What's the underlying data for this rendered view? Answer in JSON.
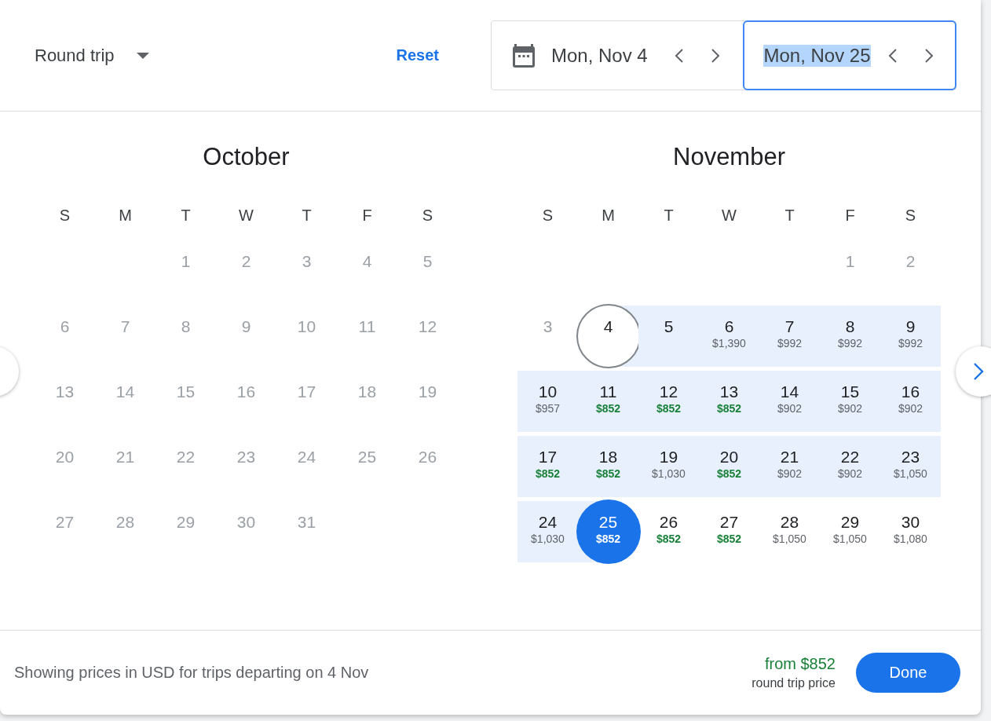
{
  "header": {
    "trip_type": "Round trip",
    "reset": "Reset",
    "dates": [
      {
        "kind": "departure",
        "value": "Mon, Nov 4",
        "selected": false,
        "text_highlighted": false
      },
      {
        "kind": "return",
        "value": "Mon, Nov 25",
        "selected": true,
        "text_highlighted": true
      }
    ]
  },
  "months": [
    {
      "name": "October",
      "weekdays": [
        "S",
        "M",
        "T",
        "W",
        "T",
        "F",
        "S"
      ],
      "weeks": [
        [
          {
            "kind": "blank"
          },
          {
            "kind": "blank"
          },
          {
            "day": "1",
            "past": true,
            "in_range": false,
            "selected": false,
            "kind": "day"
          },
          {
            "day": "2",
            "past": true,
            "in_range": false,
            "selected": false,
            "kind": "day"
          },
          {
            "day": "3",
            "past": true,
            "in_range": false,
            "selected": false,
            "kind": "day"
          },
          {
            "day": "4",
            "past": true,
            "in_range": false,
            "selected": false,
            "kind": "day"
          },
          {
            "day": "5",
            "past": true,
            "in_range": false,
            "selected": false,
            "kind": "day"
          }
        ],
        [
          {
            "day": "6",
            "past": true,
            "in_range": false,
            "selected": false,
            "kind": "day"
          },
          {
            "day": "7",
            "past": true,
            "in_range": false,
            "selected": false,
            "kind": "day"
          },
          {
            "day": "8",
            "past": true,
            "in_range": false,
            "selected": false,
            "kind": "day"
          },
          {
            "day": "9",
            "past": true,
            "in_range": false,
            "selected": false,
            "kind": "day"
          },
          {
            "day": "10",
            "past": true,
            "in_range": false,
            "selected": false,
            "kind": "day"
          },
          {
            "day": "11",
            "past": true,
            "in_range": false,
            "selected": false,
            "kind": "day"
          },
          {
            "day": "12",
            "past": true,
            "in_range": false,
            "selected": false,
            "kind": "day"
          }
        ],
        [
          {
            "day": "13",
            "past": true,
            "in_range": false,
            "selected": false,
            "kind": "day"
          },
          {
            "day": "14",
            "past": true,
            "in_range": false,
            "selected": false,
            "kind": "day"
          },
          {
            "day": "15",
            "past": true,
            "in_range": false,
            "selected": false,
            "kind": "day"
          },
          {
            "day": "16",
            "past": true,
            "in_range": false,
            "selected": false,
            "kind": "day"
          },
          {
            "day": "17",
            "past": true,
            "in_range": false,
            "selected": false,
            "kind": "day"
          },
          {
            "day": "18",
            "past": true,
            "in_range": false,
            "selected": false,
            "kind": "day"
          },
          {
            "day": "19",
            "past": true,
            "in_range": false,
            "selected": false,
            "kind": "day"
          }
        ],
        [
          {
            "day": "20",
            "past": true,
            "in_range": false,
            "selected": false,
            "kind": "day"
          },
          {
            "day": "21",
            "past": true,
            "in_range": false,
            "selected": false,
            "kind": "day"
          },
          {
            "day": "22",
            "past": true,
            "in_range": false,
            "selected": false,
            "kind": "day"
          },
          {
            "day": "23",
            "past": true,
            "in_range": false,
            "selected": false,
            "kind": "day"
          },
          {
            "day": "24",
            "past": true,
            "in_range": false,
            "selected": false,
            "kind": "day"
          },
          {
            "day": "25",
            "past": true,
            "in_range": false,
            "selected": false,
            "kind": "day"
          },
          {
            "day": "26",
            "past": true,
            "in_range": false,
            "selected": false,
            "kind": "day"
          }
        ],
        [
          {
            "day": "27",
            "past": true,
            "in_range": false,
            "selected": false,
            "kind": "day"
          },
          {
            "day": "28",
            "past": true,
            "in_range": false,
            "selected": false,
            "kind": "day"
          },
          {
            "day": "29",
            "past": true,
            "in_range": false,
            "selected": false,
            "kind": "day"
          },
          {
            "day": "30",
            "past": true,
            "in_range": false,
            "selected": false,
            "kind": "day"
          },
          {
            "day": "31",
            "past": true,
            "in_range": false,
            "selected": false,
            "kind": "day"
          },
          {
            "kind": "blank"
          },
          {
            "kind": "blank"
          }
        ]
      ]
    },
    {
      "name": "November",
      "weekdays": [
        "S",
        "M",
        "T",
        "W",
        "T",
        "F",
        "S"
      ],
      "weeks": [
        [
          {
            "kind": "blank"
          },
          {
            "kind": "blank"
          },
          {
            "kind": "blank"
          },
          {
            "kind": "blank"
          },
          {
            "kind": "blank"
          },
          {
            "day": "1",
            "past": true,
            "in_range": false,
            "selected": false,
            "kind": "day"
          },
          {
            "day": "2",
            "past": true,
            "in_range": false,
            "selected": false,
            "kind": "day"
          }
        ],
        [
          {
            "day": "3",
            "past": true,
            "in_range": false,
            "selected": false,
            "kind": "day"
          },
          {
            "day": "4",
            "past": false,
            "in_range": true,
            "selected": true,
            "kind": "departure"
          },
          {
            "day": "5",
            "past": false,
            "in_range": true,
            "selected": false,
            "kind": "day"
          },
          {
            "day": "6",
            "price": "$1,390",
            "cheap": false,
            "past": false,
            "in_range": true,
            "selected": false,
            "kind": "day"
          },
          {
            "day": "7",
            "price": "$992",
            "cheap": false,
            "past": false,
            "in_range": true,
            "selected": false,
            "kind": "day"
          },
          {
            "day": "8",
            "price": "$992",
            "cheap": false,
            "past": false,
            "in_range": true,
            "selected": false,
            "kind": "day"
          },
          {
            "day": "9",
            "price": "$992",
            "cheap": false,
            "past": false,
            "in_range": true,
            "selected": false,
            "kind": "day"
          }
        ],
        [
          {
            "day": "10",
            "price": "$957",
            "cheap": false,
            "past": false,
            "in_range": true,
            "selected": false,
            "kind": "day"
          },
          {
            "day": "11",
            "price": "$852",
            "cheap": true,
            "past": false,
            "in_range": true,
            "selected": false,
            "kind": "day"
          },
          {
            "day": "12",
            "price": "$852",
            "cheap": true,
            "past": false,
            "in_range": true,
            "selected": false,
            "kind": "day"
          },
          {
            "day": "13",
            "price": "$852",
            "cheap": true,
            "past": false,
            "in_range": true,
            "selected": false,
            "kind": "day"
          },
          {
            "day": "14",
            "price": "$902",
            "cheap": false,
            "past": false,
            "in_range": true,
            "selected": false,
            "kind": "day"
          },
          {
            "day": "15",
            "price": "$902",
            "cheap": false,
            "past": false,
            "in_range": true,
            "selected": false,
            "kind": "day"
          },
          {
            "day": "16",
            "price": "$902",
            "cheap": false,
            "past": false,
            "in_range": true,
            "selected": false,
            "kind": "day"
          }
        ],
        [
          {
            "day": "17",
            "price": "$852",
            "cheap": true,
            "past": false,
            "in_range": true,
            "selected": false,
            "kind": "day"
          },
          {
            "day": "18",
            "price": "$852",
            "cheap": true,
            "past": false,
            "in_range": true,
            "selected": false,
            "kind": "day"
          },
          {
            "day": "19",
            "price": "$1,030",
            "cheap": false,
            "past": false,
            "in_range": true,
            "selected": false,
            "kind": "day"
          },
          {
            "day": "20",
            "price": "$852",
            "cheap": true,
            "past": false,
            "in_range": true,
            "selected": false,
            "kind": "day"
          },
          {
            "day": "21",
            "price": "$902",
            "cheap": false,
            "past": false,
            "in_range": true,
            "selected": false,
            "kind": "day"
          },
          {
            "day": "22",
            "price": "$902",
            "cheap": false,
            "past": false,
            "in_range": true,
            "selected": false,
            "kind": "day"
          },
          {
            "day": "23",
            "price": "$1,050",
            "cheap": false,
            "past": false,
            "in_range": true,
            "selected": false,
            "kind": "day"
          }
        ],
        [
          {
            "day": "24",
            "price": "$1,030",
            "cheap": false,
            "past": false,
            "in_range": true,
            "selected": false,
            "kind": "day"
          },
          {
            "day": "25",
            "price": "$852",
            "cheap": true,
            "past": false,
            "in_range": true,
            "selected": true,
            "kind": "return"
          },
          {
            "day": "26",
            "price": "$852",
            "cheap": true,
            "past": false,
            "in_range": false,
            "selected": false,
            "kind": "day"
          },
          {
            "day": "27",
            "price": "$852",
            "cheap": true,
            "past": false,
            "in_range": false,
            "selected": false,
            "kind": "day"
          },
          {
            "day": "28",
            "price": "$1,050",
            "cheap": false,
            "past": false,
            "in_range": false,
            "selected": false,
            "kind": "day"
          },
          {
            "day": "29",
            "price": "$1,050",
            "cheap": false,
            "past": false,
            "in_range": false,
            "selected": false,
            "kind": "day"
          },
          {
            "day": "30",
            "price": "$1,080",
            "cheap": false,
            "past": false,
            "in_range": false,
            "selected": false,
            "kind": "day"
          }
        ]
      ]
    }
  ],
  "footer": {
    "note": "Showing prices in USD for trips departing on 4 Nov",
    "price": "from $852",
    "price_label": "round trip price",
    "done": "Done"
  }
}
